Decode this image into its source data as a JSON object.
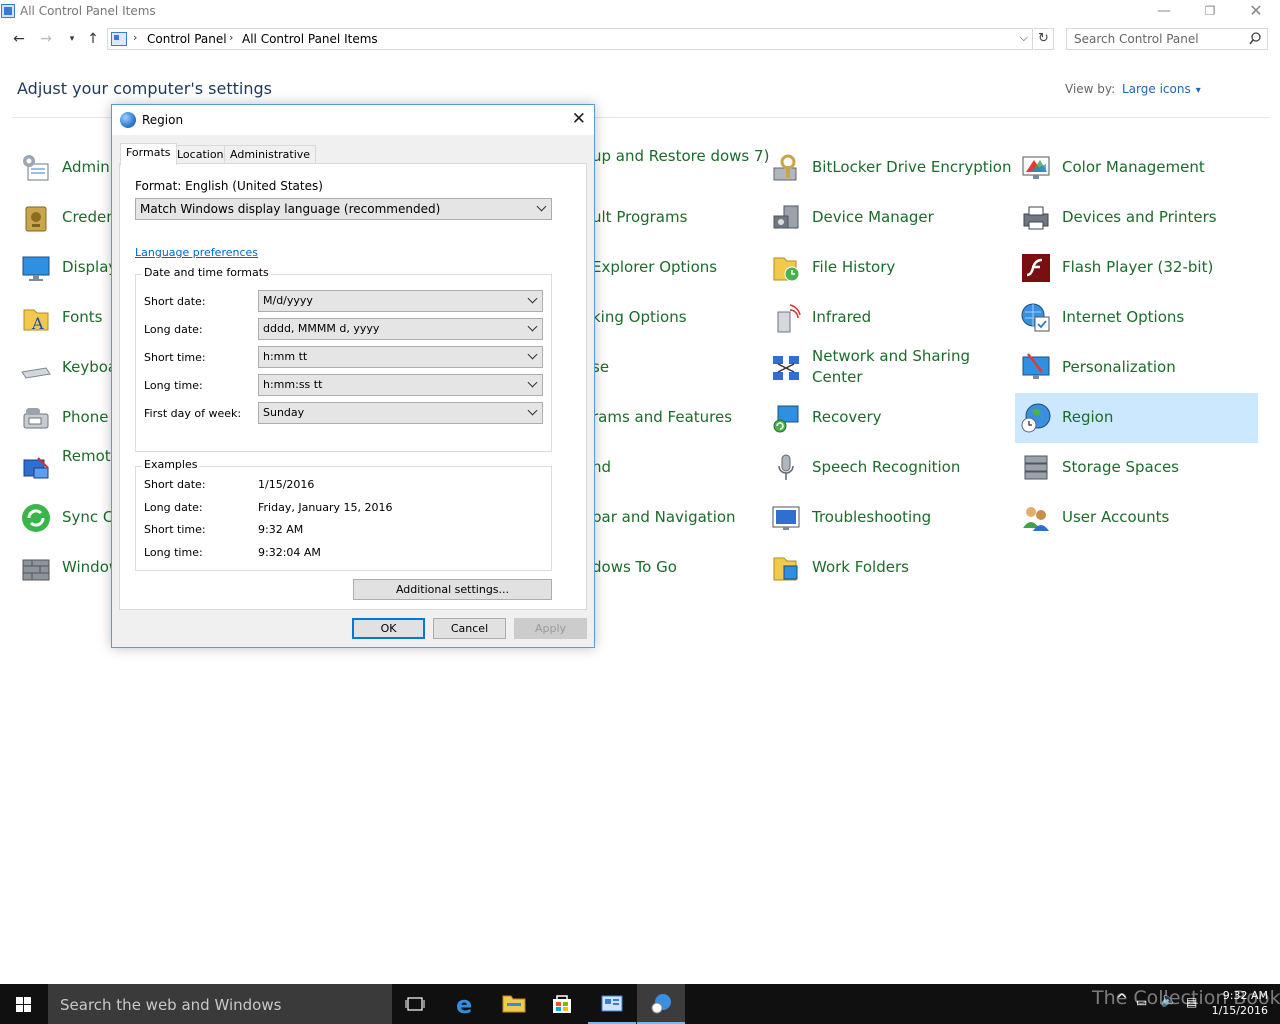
{
  "window": {
    "title": "All Control Panel Items"
  },
  "address": {
    "crumbs": [
      "Control Panel",
      "All Control Panel Items"
    ],
    "search_placeholder": "Search Control Panel"
  },
  "header": {
    "heading": "Adjust your computer's settings",
    "view_by_label": "View by:",
    "view_by_value": "Large icons"
  },
  "items": [
    {
      "label": "Admini",
      "icon": "administrative-tools-icon"
    },
    {
      "label": "Creden",
      "icon": "credential-manager-icon"
    },
    {
      "label": "Display",
      "icon": "display-icon"
    },
    {
      "label": "Fonts",
      "icon": "fonts-icon"
    },
    {
      "label": "Keyboa",
      "icon": "keyboard-icon"
    },
    {
      "label": "Phone",
      "icon": "phone-modem-icon"
    },
    {
      "label": "Remote Connec",
      "icon": "remoteapp-icon"
    },
    {
      "label": "Sync Ce",
      "icon": "sync-center-icon"
    },
    {
      "label": "Window",
      "icon": "windows-firewall-icon"
    },
    {
      "label": "up and Restore dows 7)"
    },
    {
      "label": "ult Programs"
    },
    {
      "label": "Explorer Options"
    },
    {
      "label": "king Options"
    },
    {
      "label": "se"
    },
    {
      "label": "rams and Features"
    },
    {
      "label": "nd"
    },
    {
      "label": "bar and Navigation"
    },
    {
      "label": "dows To Go"
    },
    {
      "label": "BitLocker Drive Encryption",
      "icon": "bitlocker-icon"
    },
    {
      "label": "Device Manager",
      "icon": "device-manager-icon"
    },
    {
      "label": "File History",
      "icon": "file-history-icon"
    },
    {
      "label": "Infrared",
      "icon": "infrared-icon"
    },
    {
      "label": "Network and Sharing Center",
      "icon": "network-sharing-icon"
    },
    {
      "label": "Recovery",
      "icon": "recovery-icon"
    },
    {
      "label": "Speech Recognition",
      "icon": "microphone-icon"
    },
    {
      "label": "Troubleshooting",
      "icon": "troubleshooting-icon"
    },
    {
      "label": "Work Folders",
      "icon": "work-folders-icon"
    },
    {
      "label": "Color Management",
      "icon": "color-management-icon"
    },
    {
      "label": "Devices and Printers",
      "icon": "printer-icon"
    },
    {
      "label": "Flash Player (32-bit)",
      "icon": "flash-player-icon"
    },
    {
      "label": "Internet Options",
      "icon": "internet-options-icon"
    },
    {
      "label": "Personalization",
      "icon": "personalization-icon"
    },
    {
      "label": "Region",
      "icon": "region-globe-icon",
      "selected": true
    },
    {
      "label": "Storage Spaces",
      "icon": "storage-spaces-icon"
    },
    {
      "label": "User Accounts",
      "icon": "user-accounts-icon"
    }
  ],
  "dialog": {
    "title": "Region",
    "tabs": [
      "Formats",
      "Location",
      "Administrative"
    ],
    "format_label": "Format: English (United States)",
    "format_value": "Match Windows display language (recommended)",
    "language_link": "Language preferences",
    "dtf_title": "Date and time formats",
    "dtf": [
      {
        "label": "Short date:",
        "value": "M/d/yyyy"
      },
      {
        "label": "Long date:",
        "value": "dddd, MMMM d, yyyy"
      },
      {
        "label": "Short time:",
        "value": "h:mm tt"
      },
      {
        "label": "Long time:",
        "value": "h:mm:ss tt"
      },
      {
        "label": "First day of week:",
        "value": "Sunday"
      }
    ],
    "examples_title": "Examples",
    "examples": [
      {
        "label": "Short date:",
        "value": "1/15/2016"
      },
      {
        "label": "Long date:",
        "value": "Friday, January 15, 2016"
      },
      {
        "label": "Short time:",
        "value": "9:32 AM"
      },
      {
        "label": "Long time:",
        "value": "9:32:04 AM"
      }
    ],
    "additional_label": "Additional settings...",
    "ok_label": "OK",
    "cancel_label": "Cancel",
    "apply_label": "Apply"
  },
  "taskbar": {
    "search_text": "Search the web and Windows",
    "time": "9:32 AM",
    "date": "1/15/2016",
    "watermark": "The Collection Book"
  },
  "colors": {
    "accent": "#0078d7",
    "link_green": "#1c6b2a",
    "selected_bg": "#cce8ff",
    "taskbar": "#101010"
  }
}
